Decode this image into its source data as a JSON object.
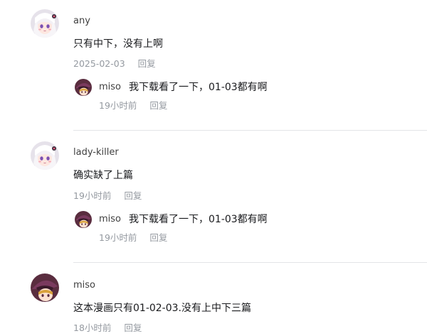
{
  "comments": [
    {
      "username": "any",
      "avatar": "anime-girl-avatar",
      "content": "只有中下，没有上啊",
      "time": "2025-02-03",
      "reply_label": "回复",
      "sub_reply": {
        "username": "miso",
        "avatar": "witch-avatar",
        "content": "我下载看了一下，01-03都有啊",
        "time": "19小时前",
        "reply_label": "回复"
      }
    },
    {
      "username": "lady-killer",
      "avatar": "anime-girl-avatar",
      "content": "确实缺了上篇",
      "time": "19小时前",
      "reply_label": "回复",
      "sub_reply": {
        "username": "miso",
        "avatar": "witch-avatar",
        "content": "我下载看了一下，01-03都有啊",
        "time": "19小时前",
        "reply_label": "回复"
      }
    },
    {
      "username": "miso",
      "avatar": "witch-avatar",
      "content": "这本漫画只有01-02-03.没有上中下三篇",
      "time": "18小时前",
      "reply_label": "回复"
    }
  ],
  "colors": {
    "text": "#18191c",
    "username": "#404040",
    "meta": "#9499a0",
    "divider": "#e3e5e7"
  }
}
